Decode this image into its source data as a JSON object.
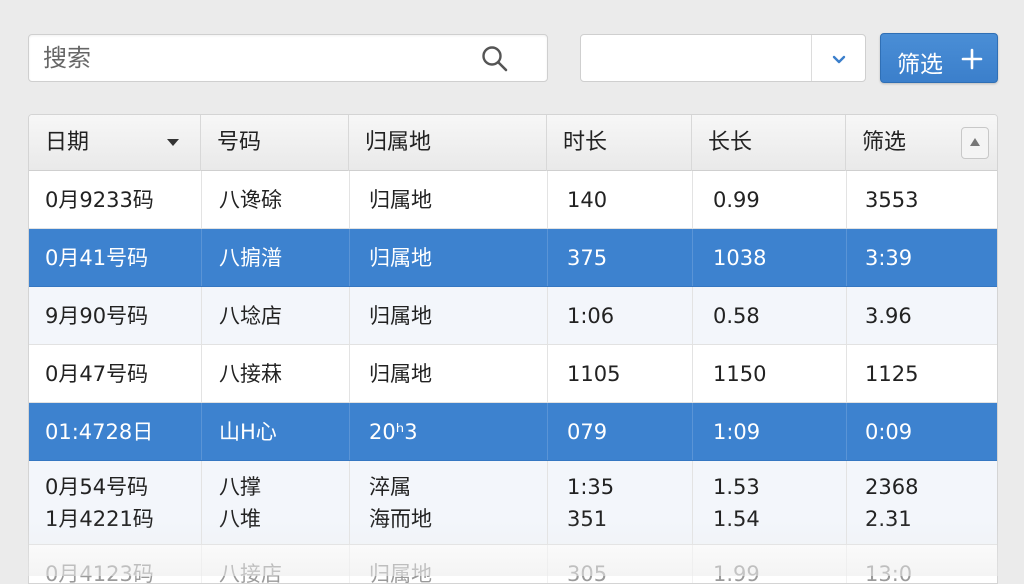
{
  "search": {
    "placeholder": "搜索"
  },
  "select": {
    "value": ""
  },
  "filter_button": {
    "label": "筛选"
  },
  "table": {
    "headers": [
      "日期",
      "号码",
      "归属地",
      "时长",
      "长长",
      "筛选"
    ],
    "rows": [
      {
        "state": "plain",
        "lines": [
          [
            "0月9233码",
            "八谗硢",
            "归属地",
            "140",
            "0.99",
            "3553"
          ]
        ]
      },
      {
        "state": "selected",
        "lines": [
          [
            "0月41号码",
            "八掮潽",
            "归属地",
            "375",
            "1038",
            "3:39"
          ]
        ]
      },
      {
        "state": "alt",
        "lines": [
          [
            "9月90号码",
            "八埝店",
            "归属地",
            "1:06",
            "0.58",
            "3.96"
          ]
        ]
      },
      {
        "state": "plain",
        "lines": [
          [
            "0月47号码",
            "八接菻",
            "归属地",
            "1105",
            "1150",
            "1125"
          ]
        ]
      },
      {
        "state": "selected",
        "lines": [
          [
            "01:4728日",
            "山H心",
            "20ʰ3",
            "079",
            "1:09",
            "0:09"
          ]
        ]
      },
      {
        "state": "alt",
        "lines": [
          [
            "0月54号码",
            "八撑",
            "淬属",
            "1:35",
            "1.53",
            "2368"
          ],
          [
            "1月4221码",
            "八堆",
            "海而地",
            "351",
            "1.54",
            "2.31"
          ]
        ]
      },
      {
        "state": "faded",
        "lines": [
          [
            "0月4123码",
            "八接店",
            "归属地",
            "305",
            "1.99",
            "13:0"
          ]
        ]
      }
    ]
  }
}
